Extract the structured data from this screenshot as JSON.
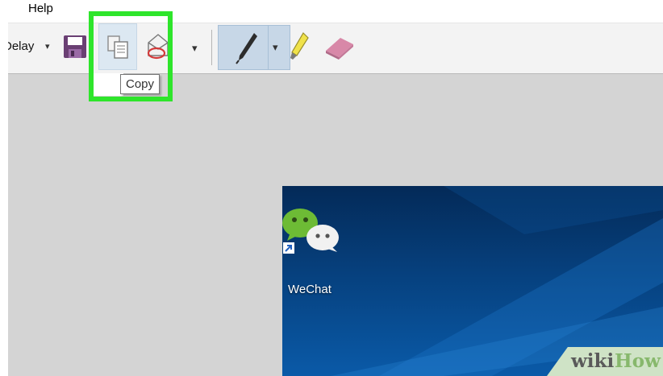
{
  "menubar": {
    "prev_item_fragment": ":",
    "help_label": "Help"
  },
  "toolbar": {
    "delay_label": "Delay",
    "caret_glyph": "▾",
    "tooltip_text": "Copy"
  },
  "desktop": {
    "icon_label": "WeChat"
  },
  "watermark": {
    "wiki": "wiki",
    "how": "How"
  },
  "colors": {
    "highlight": "#2ee52b",
    "pen_group_bg": "#c7d7e7",
    "copy_hover_bg": "#dce8f2",
    "desktop_bg": "#06407d",
    "wechat_green": "#6dbb35"
  },
  "icons": [
    "save-icon",
    "copy-icon",
    "send-email-icon",
    "pen-icon",
    "highlighter-icon",
    "eraser-icon",
    "wechat-icon",
    "shortcut-arrow-icon"
  ]
}
